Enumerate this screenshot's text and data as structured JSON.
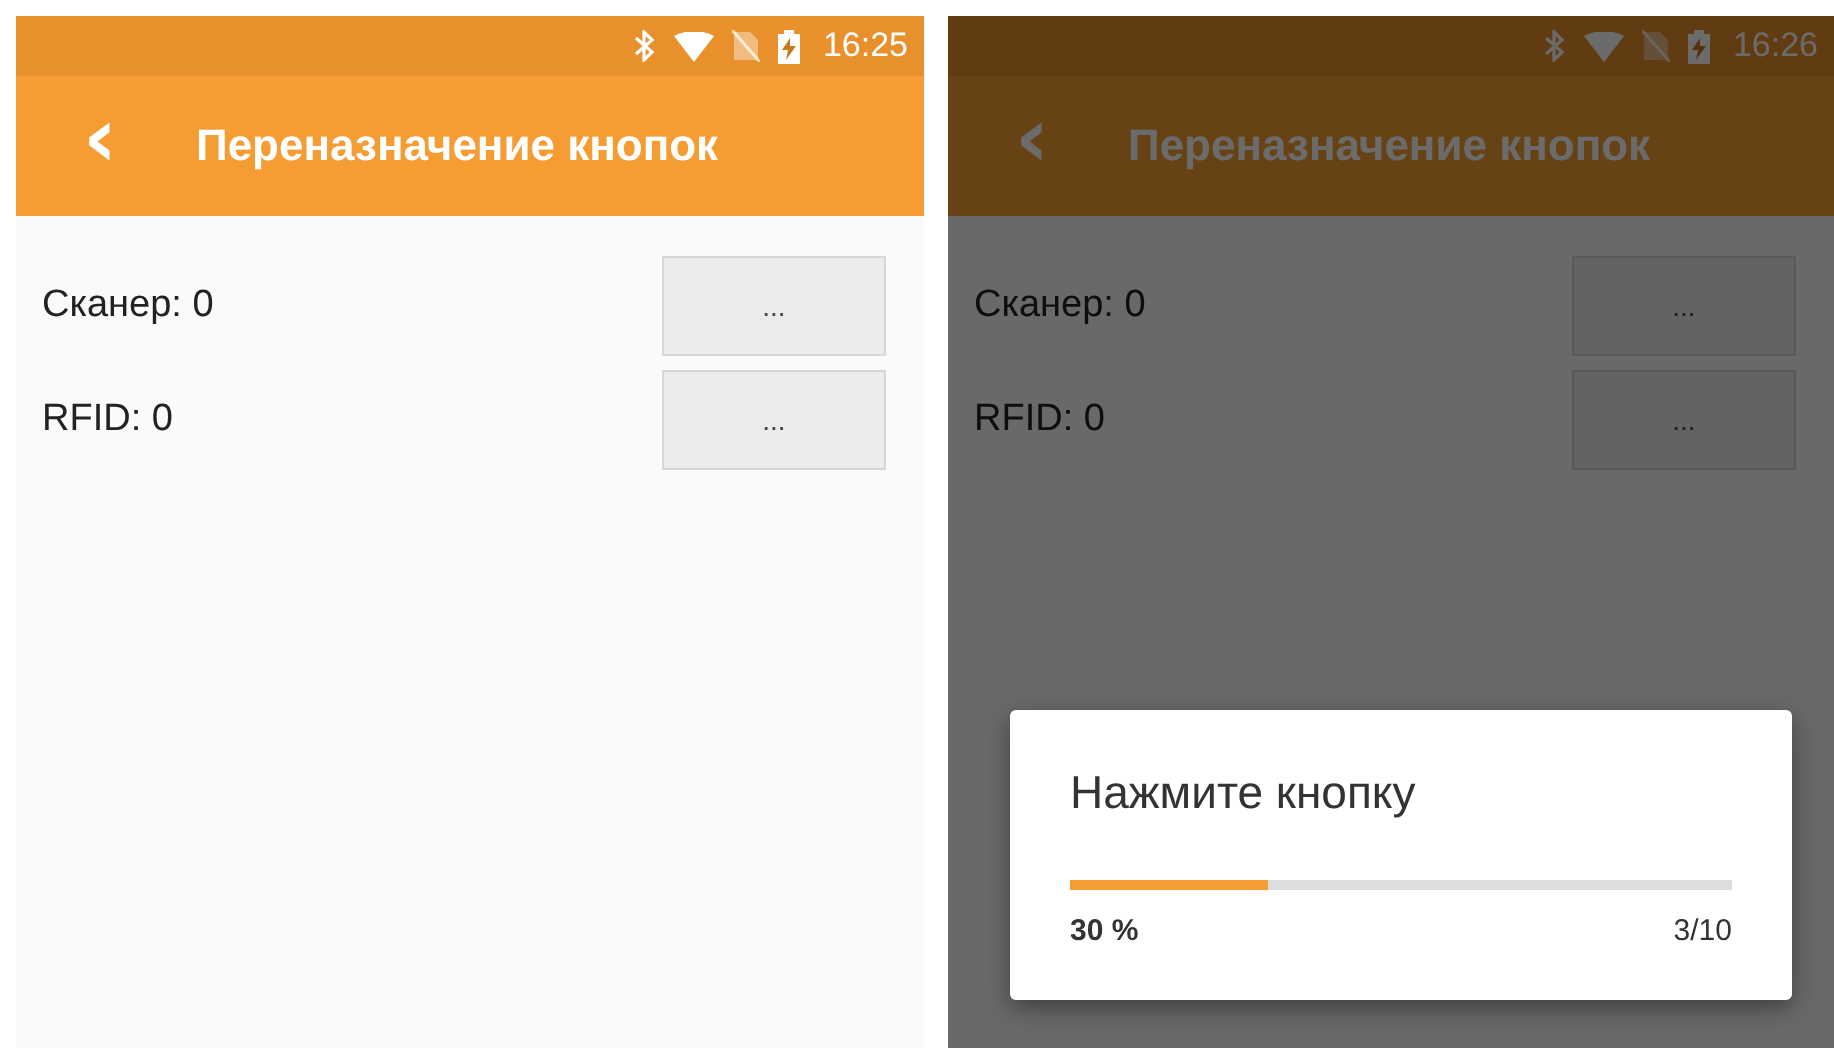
{
  "screens": [
    {
      "status_bar": {
        "time": "16:25"
      },
      "app_bar": {
        "back": "‹",
        "title": "Переназначение кнопок"
      },
      "rows": [
        {
          "label": "Сканер: 0",
          "button": "..."
        },
        {
          "label": "RFID: 0",
          "button": "..."
        }
      ]
    },
    {
      "status_bar": {
        "time": "16:26"
      },
      "app_bar": {
        "back": "‹",
        "title": "Переназначение кнопок"
      },
      "rows": [
        {
          "label": "Сканер: 0",
          "button": "..."
        },
        {
          "label": "RFID: 0",
          "button": "..."
        }
      ],
      "dialog": {
        "title": "Нажмите кнопку",
        "level": 0.3,
        "percent": "30 %",
        "count": "3/10"
      }
    }
  ]
}
